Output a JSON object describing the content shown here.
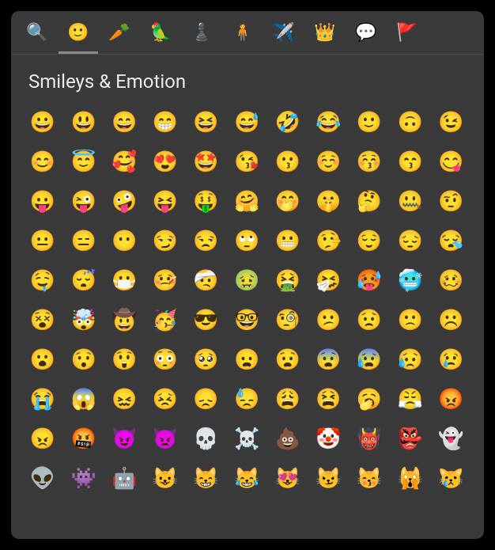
{
  "tabs": [
    {
      "name": "search-tab",
      "icon": "🔍",
      "active": false
    },
    {
      "name": "smileys-tab",
      "icon": "🙂",
      "active": true
    },
    {
      "name": "food-tab",
      "icon": "🥕",
      "active": false
    },
    {
      "name": "animals-tab",
      "icon": "🦜",
      "active": false
    },
    {
      "name": "activities-tab",
      "icon": "♟️",
      "active": false
    },
    {
      "name": "people-tab",
      "icon": "🧍",
      "active": false
    },
    {
      "name": "travel-tab",
      "icon": "✈️",
      "active": false
    },
    {
      "name": "objects-tab",
      "icon": "👑",
      "active": false
    },
    {
      "name": "symbols-tab",
      "icon": "💬",
      "active": false
    },
    {
      "name": "flags-tab",
      "icon": "🚩",
      "active": false
    }
  ],
  "section": {
    "title": "Smileys & Emotion"
  },
  "emojis": [
    "😀",
    "😃",
    "😄",
    "😁",
    "😆",
    "😅",
    "🤣",
    "😂",
    "🙂",
    "🙃",
    "😉",
    "😊",
    "😇",
    "🥰",
    "😍",
    "🤩",
    "😘",
    "😗",
    "☺️",
    "😚",
    "😙",
    "😋",
    "😛",
    "😜",
    "🤪",
    "😝",
    "🤑",
    "🤗",
    "🤭",
    "🤫",
    "🤔",
    "🤐",
    "🤨",
    "😐",
    "😑",
    "😶",
    "😏",
    "😒",
    "🙄",
    "😬",
    "🤥",
    "😌",
    "😔",
    "😪",
    "🤤",
    "😴",
    "😷",
    "🤒",
    "🤕",
    "🤢",
    "🤮",
    "🤧",
    "🥵",
    "🥶",
    "🥴",
    "😵",
    "🤯",
    "🤠",
    "🥳",
    "😎",
    "🤓",
    "🧐",
    "😕",
    "😟",
    "🙁",
    "☹️",
    "😮",
    "😯",
    "😲",
    "😳",
    "🥺",
    "😦",
    "😧",
    "😨",
    "😰",
    "😥",
    "😢",
    "😭",
    "😱",
    "😖",
    "😣",
    "😞",
    "😓",
    "😩",
    "😫",
    "🥱",
    "😤",
    "😡",
    "😠",
    "🤬",
    "😈",
    "👿",
    "💀",
    "☠️",
    "💩",
    "🤡",
    "👹",
    "👺",
    "👻",
    "👽",
    "👾",
    "🤖",
    "😺",
    "😸",
    "😹",
    "😻",
    "😼",
    "😽",
    "🙀",
    "😿"
  ]
}
